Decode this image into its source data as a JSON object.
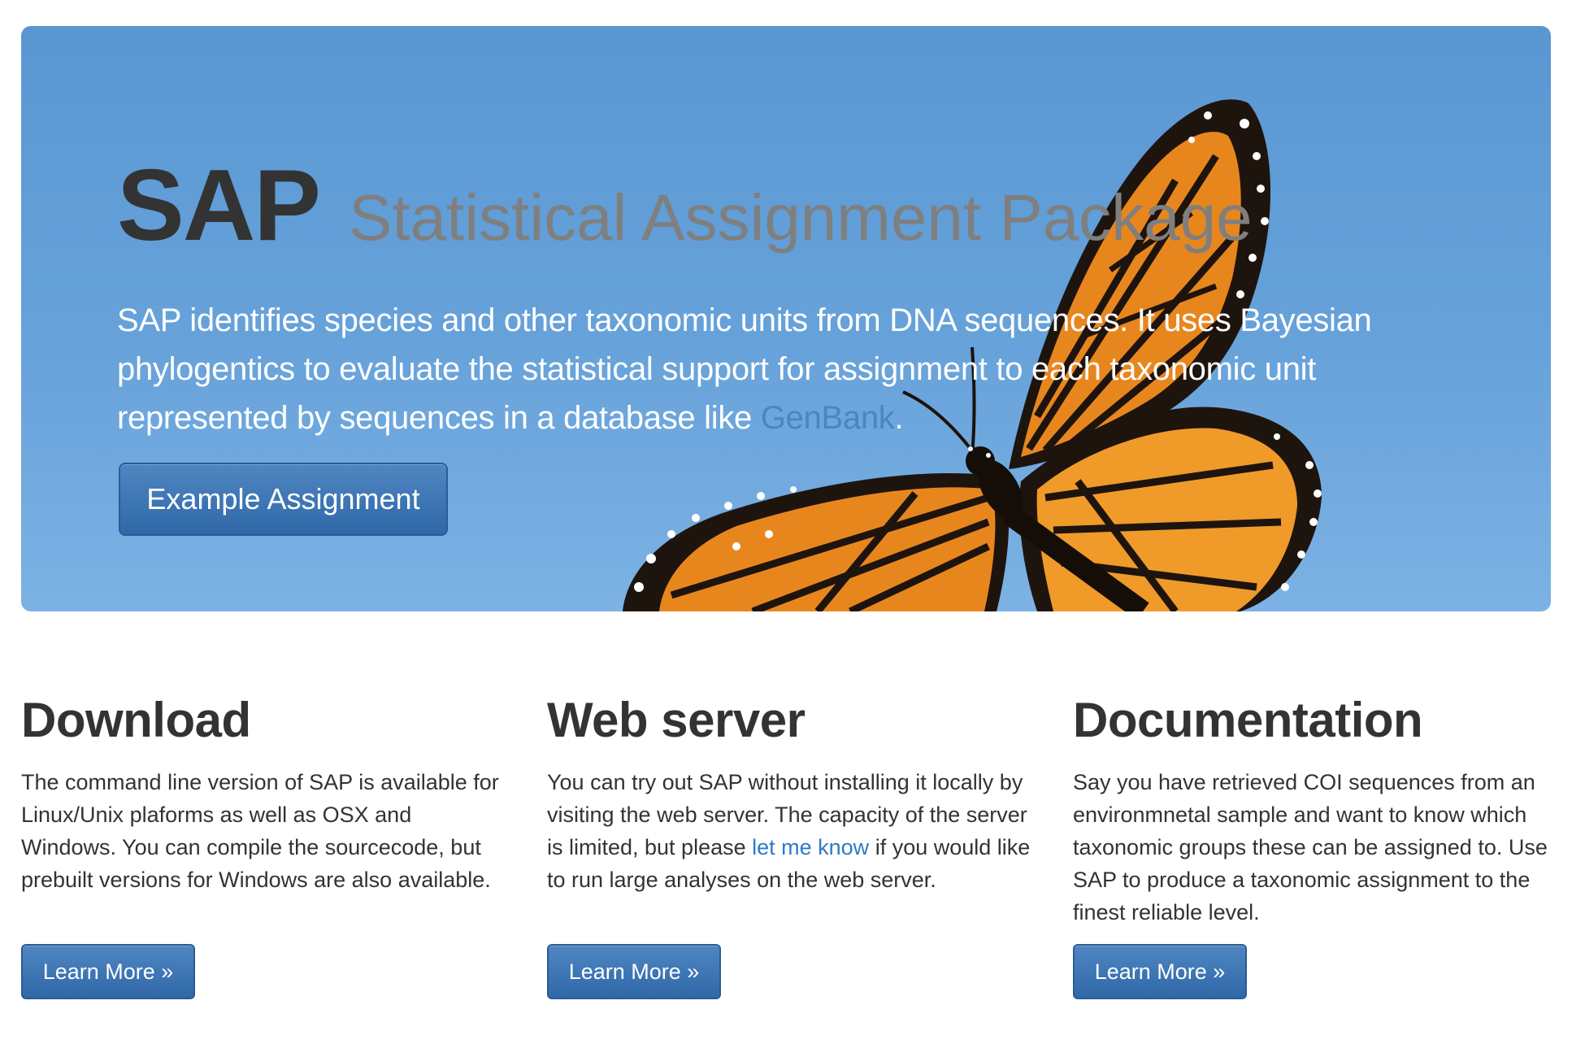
{
  "hero": {
    "title": "SAP",
    "subtitle": "Statistical Assignment Package",
    "lead_before_link": "SAP identifies species and other taxonomic units from DNA sequences. It uses Bayesian phylogentics to evaluate the statistical support for assignment to each taxonomic unit represented by sequences in a database like ",
    "lead_link": "GenBank",
    "lead_after_link": ".",
    "button_label": "Example Assignment"
  },
  "columns": [
    {
      "heading": "Download",
      "text": "The command line version of SAP is available for Linux/Unix plaforms as well as OSX and Windows. You can compile the sourcecode, but prebuilt versions for Windows are also available.",
      "button_label": "Learn More »"
    },
    {
      "heading": "Web server",
      "text_before_link": "You can try out SAP without installing it locally by visiting the web server. The capacity of the server is limited, but please ",
      "link": "let me know",
      "text_after_link": " if you would like to run large analyses on the web server.",
      "button_label": "Learn More »"
    },
    {
      "heading": "Documentation",
      "text": "Say you have retrieved COI sequences from an environmnetal sample and want to know which taxonomic groups these can be assigned to. Use SAP to produce a taxonomic assignment to the finest reliable level.",
      "button_label": "Learn More »"
    }
  ],
  "colors": {
    "hero_background": "#5a97d2",
    "button_primary": "#3a72b2",
    "link": "#2f79c6",
    "butterfly_orange": "#e8861e",
    "butterfly_black": "#1e140e"
  },
  "icons": {
    "hero_image": "monarch-butterfly-image"
  }
}
